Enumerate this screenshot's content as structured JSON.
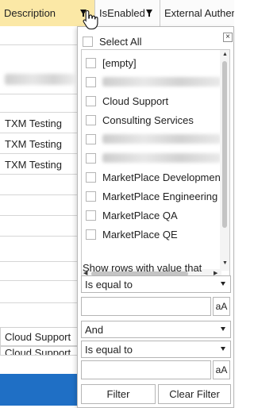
{
  "header": {
    "columns": [
      {
        "label": "Description"
      },
      {
        "label": "IsEnabled"
      },
      {
        "label": "External Auther"
      }
    ]
  },
  "grid": {
    "visible_rows": [
      "TXM Testing",
      "TXM Testing",
      "TXM Testing"
    ],
    "bottom_rows": [
      "Cloud Support",
      "Cloud Support"
    ]
  },
  "filter": {
    "select_all": "Select All",
    "close": "×",
    "items": [
      {
        "label": "[empty]"
      },
      {
        "label": ""
      },
      {
        "label": "Cloud Support"
      },
      {
        "label": "Consulting Services"
      },
      {
        "label": ""
      },
      {
        "label": ""
      },
      {
        "label": "MarketPlace Development"
      },
      {
        "label": "MarketPlace Engineering"
      },
      {
        "label": "MarketPlace QA"
      },
      {
        "label": "MarketPlace QE"
      }
    ],
    "show_rows_label": "Show rows with value that",
    "condition1": "Is equal to",
    "case_button": "aA",
    "logical_operator": "And",
    "condition2": "Is equal to",
    "filter_button": "Filter",
    "clear_button": "Clear Filter"
  },
  "colors": {
    "active_header": "#fbe8a6",
    "band_blue": "#1f6fc5"
  }
}
